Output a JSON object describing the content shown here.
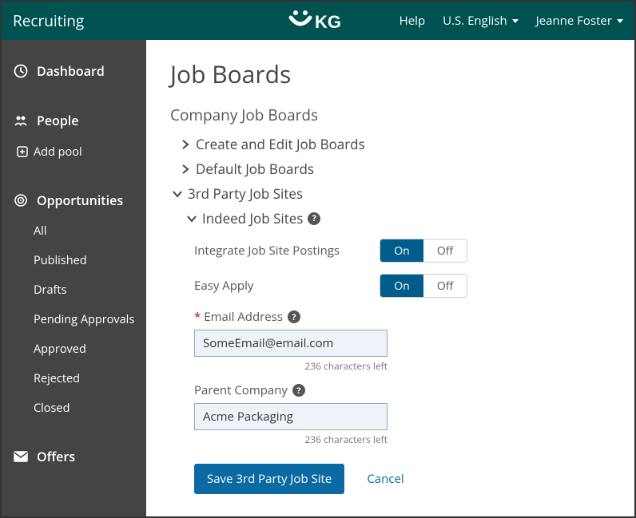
{
  "topbar": {
    "app_name": "Recruiting",
    "help_label": "Help",
    "locale_label": "U.S. English",
    "user_name": "Jeanne Foster"
  },
  "sidebar": {
    "dashboard": "Dashboard",
    "people": "People",
    "add_pool": "Add pool",
    "opportunities": "Opportunities",
    "opp_items": [
      "All",
      "Published",
      "Drafts",
      "Pending Approvals",
      "Approved",
      "Rejected",
      "Closed"
    ],
    "offers": "Offers"
  },
  "page": {
    "title": "Job Boards",
    "company_boards": "Company Job Boards",
    "create_edit": "Create and Edit Job Boards",
    "default_boards": "Default Job Boards",
    "third_party": "3rd Party Job Sites",
    "indeed": "Indeed Job Sites"
  },
  "form": {
    "integrate_label": "Integrate Job Site Postings",
    "easy_apply_label": "Easy Apply",
    "on": "On",
    "off": "Off",
    "email_label": "Email Address",
    "email_value": "SomeEmail@email.com",
    "email_chars": "236 characters left",
    "parent_label": "Parent Company",
    "parent_value": "Acme Packaging",
    "parent_chars": "236 characters left",
    "save_label": "Save 3rd Party Job Site",
    "cancel_label": "Cancel"
  }
}
